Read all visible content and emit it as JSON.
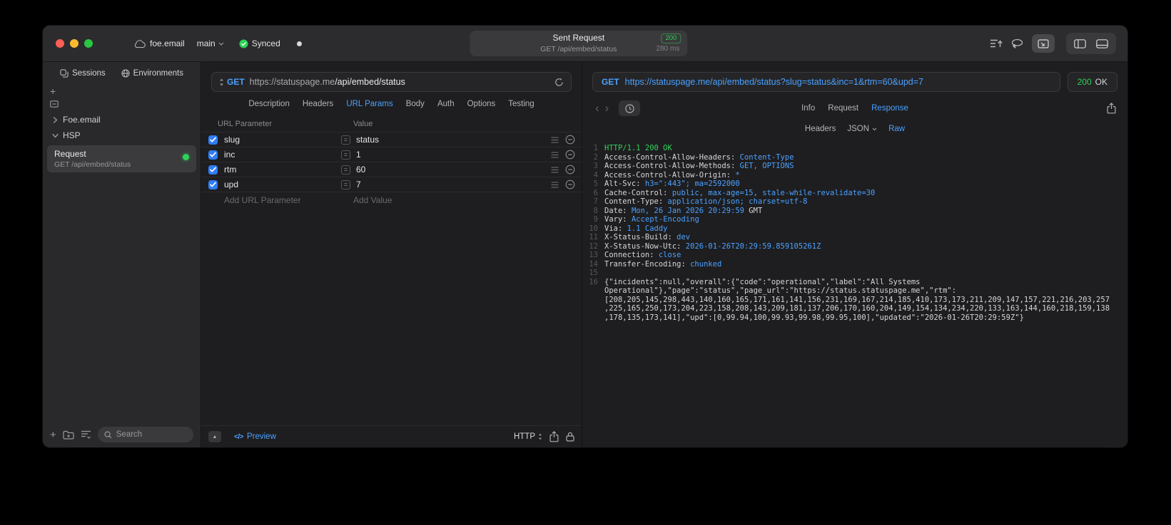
{
  "colors": {
    "accent": "#4ba1ff",
    "success_green": "#30d158",
    "checkbox_blue": "#2f7cf6"
  },
  "titlebar": {
    "project": "foe.email",
    "branch": "main",
    "sync": "Synced",
    "title": "Sent Request",
    "status_code": "200",
    "request_line": "GET /api/embed/status",
    "duration": "280 ms"
  },
  "sidebar": {
    "tabs": [
      "Sessions",
      "Environments"
    ],
    "tree": [
      {
        "label": "Foe.email",
        "expanded": false
      },
      {
        "label": "HSP",
        "expanded": true
      }
    ],
    "request": {
      "title": "Request",
      "subtitle": "GET /api/embed/status"
    },
    "search_placeholder": "Search"
  },
  "request_panel": {
    "method": "GET",
    "url_host": "https://statuspage.me",
    "url_path": "/api/embed/status",
    "tabs": [
      "Description",
      "Headers",
      "URL Params",
      "Body",
      "Auth",
      "Options",
      "Testing"
    ],
    "active_tab": "URL Params",
    "param_columns": [
      "URL Parameter",
      "Value"
    ],
    "params": [
      {
        "name": "slug",
        "value": "status",
        "checked": true
      },
      {
        "name": "inc",
        "value": "1",
        "checked": true
      },
      {
        "name": "rtm",
        "value": "60",
        "checked": true
      },
      {
        "name": "upd",
        "value": "7",
        "checked": true
      }
    ],
    "add_name_placeholder": "Add URL Parameter",
    "add_value_placeholder": "Add Value",
    "preview_label": "Preview",
    "protocol": "HTTP"
  },
  "response_panel": {
    "method": "GET",
    "url": "https://statuspage.me/api/embed/status?slug=status&inc=1&rtm=60&upd=7",
    "status_code": "200",
    "status_text": "OK",
    "tabs": [
      "Info",
      "Request",
      "Response"
    ],
    "active_tab": "Response",
    "subtabs": [
      {
        "label": "Headers"
      },
      {
        "label": "JSON",
        "dropdown": true
      },
      {
        "label": "Raw"
      }
    ],
    "active_subtab": "Raw",
    "lines": [
      {
        "n": "1",
        "segments": [
          {
            "t": "HTTP/1.1 200 OK",
            "c": "green"
          }
        ]
      },
      {
        "n": "2",
        "segments": [
          {
            "t": "Access-Control-Allow-Headers: ",
            "c": "plain"
          },
          {
            "t": "Content-Type",
            "c": "blue"
          }
        ]
      },
      {
        "n": "3",
        "segments": [
          {
            "t": "Access-Control-Allow-Methods: ",
            "c": "plain"
          },
          {
            "t": "GET, OPTIONS",
            "c": "blue"
          }
        ]
      },
      {
        "n": "4",
        "segments": [
          {
            "t": "Access-Control-Allow-Origin: ",
            "c": "plain"
          },
          {
            "t": "*",
            "c": "blue"
          }
        ]
      },
      {
        "n": "5",
        "segments": [
          {
            "t": "Alt-Svc: ",
            "c": "plain"
          },
          {
            "t": "h3=\":443\"; ma=2592000",
            "c": "blue"
          }
        ]
      },
      {
        "n": "6",
        "segments": [
          {
            "t": "Cache-Control: ",
            "c": "plain"
          },
          {
            "t": "public, max-age=15, stale-while-revalidate=30",
            "c": "blue"
          }
        ]
      },
      {
        "n": "7",
        "segments": [
          {
            "t": "Content-Type: ",
            "c": "plain"
          },
          {
            "t": "application/json; charset=utf-8",
            "c": "blue"
          }
        ]
      },
      {
        "n": "8",
        "segments": [
          {
            "t": "Date: ",
            "c": "plain"
          },
          {
            "t": "Mon, 26 Jan 2026 20:29:59",
            "c": "blue"
          },
          {
            "t": " GMT",
            "c": "plain"
          }
        ]
      },
      {
        "n": "9",
        "segments": [
          {
            "t": "Vary: ",
            "c": "plain"
          },
          {
            "t": "Accept-Encoding",
            "c": "blue"
          }
        ]
      },
      {
        "n": "10",
        "segments": [
          {
            "t": "Via: ",
            "c": "plain"
          },
          {
            "t": "1.1 Caddy",
            "c": "blue"
          }
        ]
      },
      {
        "n": "11",
        "segments": [
          {
            "t": "X-Status-Build: ",
            "c": "plain"
          },
          {
            "t": "dev",
            "c": "blue"
          }
        ]
      },
      {
        "n": "12",
        "segments": [
          {
            "t": "X-Status-Now-Utc: ",
            "c": "plain"
          },
          {
            "t": "2026-01-26T20:29:59.859105261Z",
            "c": "blue"
          }
        ]
      },
      {
        "n": "13",
        "segments": [
          {
            "t": "Connection: ",
            "c": "plain"
          },
          {
            "t": "close",
            "c": "blue"
          }
        ]
      },
      {
        "n": "14",
        "segments": [
          {
            "t": "Transfer-Encoding: ",
            "c": "plain"
          },
          {
            "t": "chunked",
            "c": "blue"
          }
        ]
      },
      {
        "n": "15",
        "segments": []
      },
      {
        "n": "16",
        "segments": [
          {
            "t": "{\"incidents\":null,\"overall\":{\"code\":\"operational\",\"label\":\"All Systems Operational\"},\"page\":\"status\",\"page_url\":\"https://status.statuspage.me\",\"rtm\":[208,205,145,298,443,140,160,165,171,161,141,156,231,169,167,214,185,410,173,173,211,209,147,157,221,216,203,257,225,165,250,173,204,223,158,208,143,209,181,137,206,170,160,204,149,154,134,234,220,133,163,144,160,218,159,138,178,135,173,141],\"upd\":[0,99.94,100,99.93,99.98,99.95,100],\"updated\":\"2026-01-26T20:29:59Z\"}",
            "c": "plain"
          }
        ]
      }
    ]
  }
}
